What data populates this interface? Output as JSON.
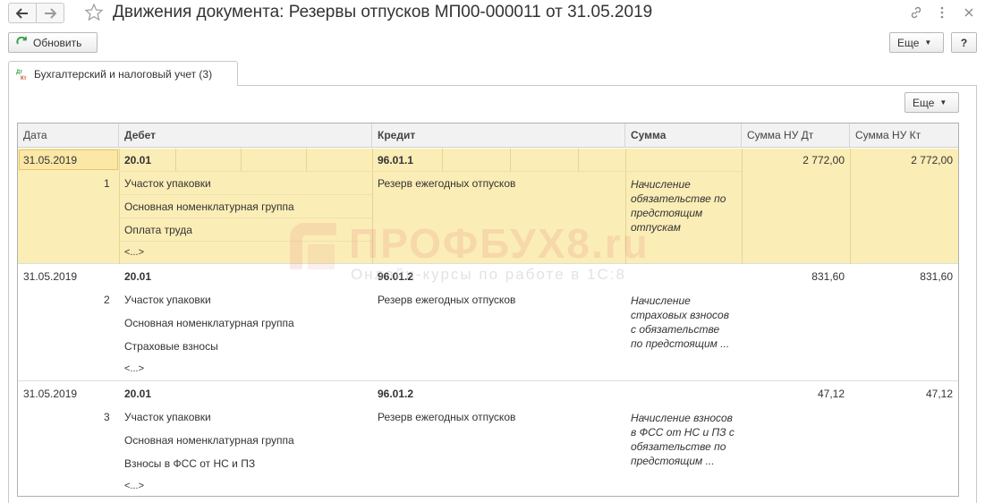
{
  "titlebar": {
    "title": "Движения документа: Резервы отпусков МП00-000011 от 31.05.2019",
    "back_icon": "arrow-left-icon",
    "forward_icon": "arrow-right-icon",
    "favorite_icon": "star-icon",
    "link_icon": "link-icon",
    "more_icon": "more-vertical-icon",
    "close_icon": "close-icon"
  },
  "toolbar": {
    "refresh_label": "Обновить",
    "more_label": "Еще",
    "help_label": "?"
  },
  "tab": {
    "label": "Бухгалтерский и налоговый учет (3)",
    "icon": "dt-kt-icon"
  },
  "panel": {
    "more_label": "Еще"
  },
  "table": {
    "columns": [
      "Дата",
      "Дебет",
      "Кредит",
      "Сумма",
      "Сумма НУ Дт",
      "Сумма НУ Кт"
    ],
    "rows": [
      {
        "date": "31.05.2019",
        "num": "1",
        "debit_account": "20.01",
        "debit_sub": [
          "Участок упаковки",
          "Основная номенклатурная группа",
          "Оплата труда",
          "<...>"
        ],
        "credit_account": "96.01.1",
        "credit_sub": "Резерв ежегодных отпусков",
        "content": "Начисление обязательстве по предстоящим отпускам",
        "sum_nu_dt": "2 772,00",
        "sum_nu_kt": "2 772,00"
      },
      {
        "date": "31.05.2019",
        "num": "2",
        "debit_account": "20.01",
        "debit_sub": [
          "Участок упаковки",
          "Основная номенклатурная группа",
          "Страховые взносы",
          "<...>"
        ],
        "credit_account": "96.01.2",
        "credit_sub": "Резерв ежегодных отпусков",
        "content": "Начисление страховых взносов с обязательстве по предстоящим ...",
        "sum_nu_dt": "831,60",
        "sum_nu_kt": "831,60"
      },
      {
        "date": "31.05.2019",
        "num": "3",
        "debit_account": "20.01",
        "debit_sub": [
          "Участок упаковки",
          "Основная номенклатурная группа",
          "Взносы в ФСС от НС и ПЗ",
          "<...>"
        ],
        "credit_account": "96.01.2",
        "credit_sub": "Резерв ежегодных отпусков",
        "content": "Начисление взносов в ФСС от НС и ПЗ с обязательстве по предстоящим ...",
        "sum_nu_dt": "47,12",
        "sum_nu_kt": "47,12"
      }
    ]
  },
  "watermark": {
    "main": "ПРОФБУХ8.ru",
    "sub": "Онлайн-курсы по работе в 1С:8"
  },
  "colors": {
    "selected_row": "#fbedb6",
    "header_bg": "#f2f2f2",
    "refresh_icon": "#3aa34a"
  }
}
